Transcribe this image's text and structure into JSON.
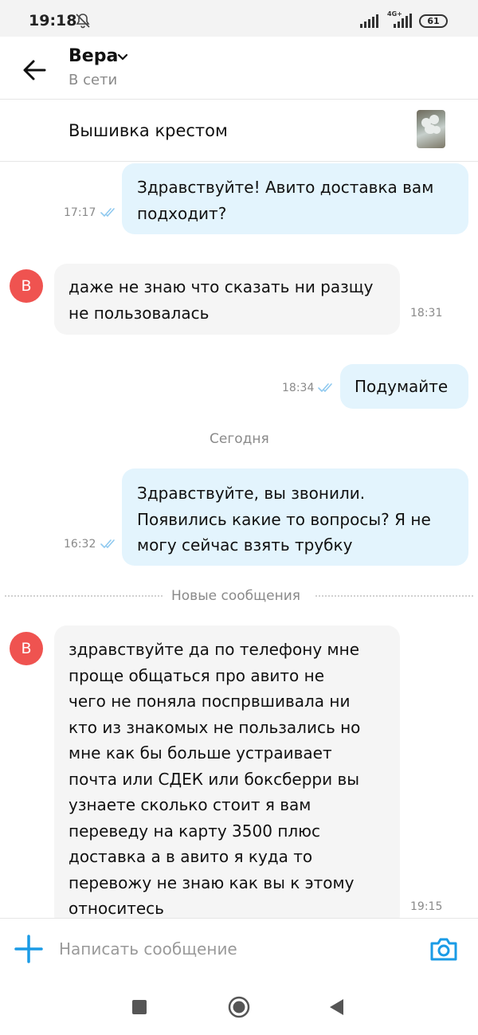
{
  "status_bar": {
    "time": "19:18",
    "network": "4G+",
    "battery": "61"
  },
  "header": {
    "name": "Вера",
    "status": "В сети"
  },
  "listing": {
    "title": "Вышивка крестом"
  },
  "messages": [
    {
      "lines": [
        "Здравствуйте! Авито доставка вам",
        "подходит?"
      ],
      "time": "17:17"
    },
    {
      "lines": [
        "даже не знаю что сказать ни разщу",
        "не пользовалась"
      ],
      "time": "18:31",
      "avatar": "В"
    },
    {
      "lines": [
        "Подумайте"
      ],
      "time": "18:34"
    },
    {
      "lines": [
        "Здравствуйте, вы звонили.",
        "Появились какие то вопросы? Я не",
        "могу сейчас взять трубку"
      ],
      "time": "16:32"
    },
    {
      "lines": [
        "здравствуйте  да по телефону мне",
        "проще общаться  про авито не",
        "чего не поняла поспрвшивала  ни",
        "кто из знакомых не пользались но",
        "мне как бы больше устраивает",
        "почта или СДЕК или боксберри вы",
        "узнаете сколько стоит я вам",
        "переведу на карту 3500 плюс",
        "доставка  а в авито я куда то",
        "перевожу не знаю как вы к этому",
        "относитесь"
      ],
      "time": "19:15",
      "avatar": "В"
    }
  ],
  "dividers": {
    "today": "Сегодня",
    "new_messages": "Новые сообщения"
  },
  "composer": {
    "placeholder": "Написать сообщение"
  },
  "colors": {
    "accent": "#1a9be6",
    "outgoing_bubble": "#e3f4fd",
    "incoming_bubble": "#f5f5f5",
    "avatar": "#ef5350"
  },
  "icons": [
    "bell-off-icon",
    "signal-icon",
    "battery-icon",
    "back-arrow-icon",
    "chevron-down-icon",
    "double-check-icon",
    "plus-icon",
    "camera-icon",
    "nav-square-icon",
    "nav-home-icon",
    "nav-back-icon"
  ]
}
